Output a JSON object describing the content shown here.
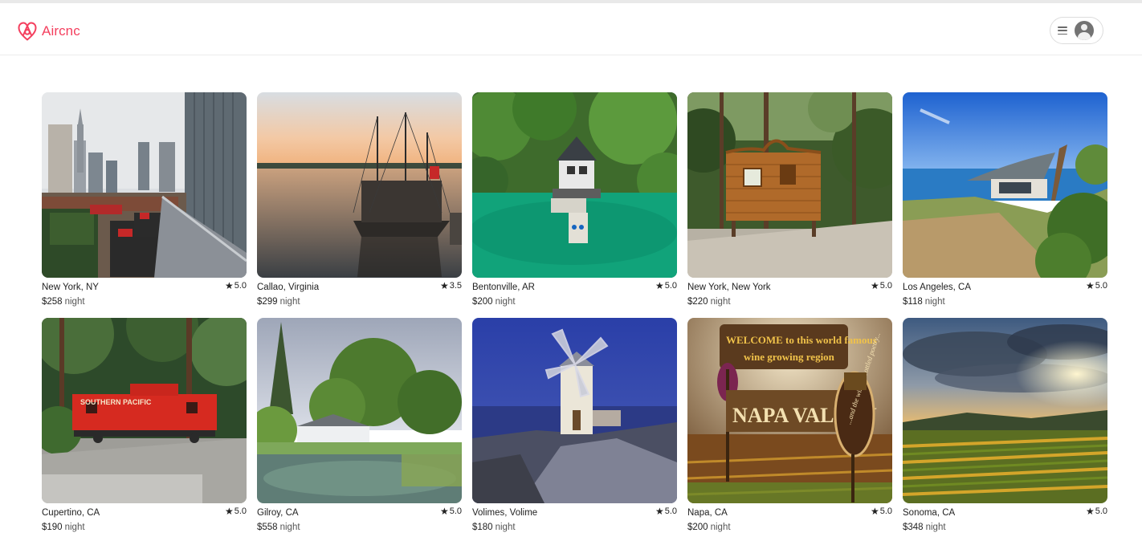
{
  "app": {
    "name": "Aircnc",
    "brand_color": "#f43f5e"
  },
  "navbar": {
    "menu_icon": "hamburger-icon",
    "avatar_icon": "user-avatar-icon"
  },
  "listings": [
    {
      "location": "New York, NY",
      "rating": "5.0",
      "price": "$258",
      "unit": "night",
      "photo": "rooftop-terrace-skyline"
    },
    {
      "location": "Callao, Virginia",
      "rating": "3.5",
      "price": "$299",
      "unit": "night",
      "photo": "pirate-ship-sunset"
    },
    {
      "location": "Bentonville, AR",
      "rating": "5.0",
      "price": "$200",
      "unit": "night",
      "photo": "lake-house-forest"
    },
    {
      "location": "New York, New York",
      "rating": "5.0",
      "price": "$220",
      "unit": "night",
      "photo": "wooden-treehouse"
    },
    {
      "location": "Los Angeles, CA",
      "rating": "5.0",
      "price": "$118",
      "unit": "night",
      "photo": "coastal-modern-house"
    },
    {
      "location": "Cupertino, CA",
      "rating": "5.0",
      "price": "$190",
      "unit": "night",
      "photo": "red-caboose-forest"
    },
    {
      "location": "Gilroy, CA",
      "rating": "5.0",
      "price": "$558",
      "unit": "night",
      "photo": "pond-oak-estate"
    },
    {
      "location": "Volimes, Volime",
      "rating": "5.0",
      "price": "$180",
      "unit": "night",
      "photo": "windmill-night"
    },
    {
      "location": "Napa, CA",
      "rating": "5.0",
      "price": "$200",
      "unit": "night",
      "photo": "napa-valley-sign",
      "sign_lines": [
        "WELCOME to this world famous",
        "wine growing region",
        "NAPA VALLEY",
        "...and the wine is bottled poetry..."
      ]
    },
    {
      "location": "Sonoma, CA",
      "rating": "5.0",
      "price": "$348",
      "unit": "night",
      "photo": "vineyard-sunset"
    }
  ]
}
